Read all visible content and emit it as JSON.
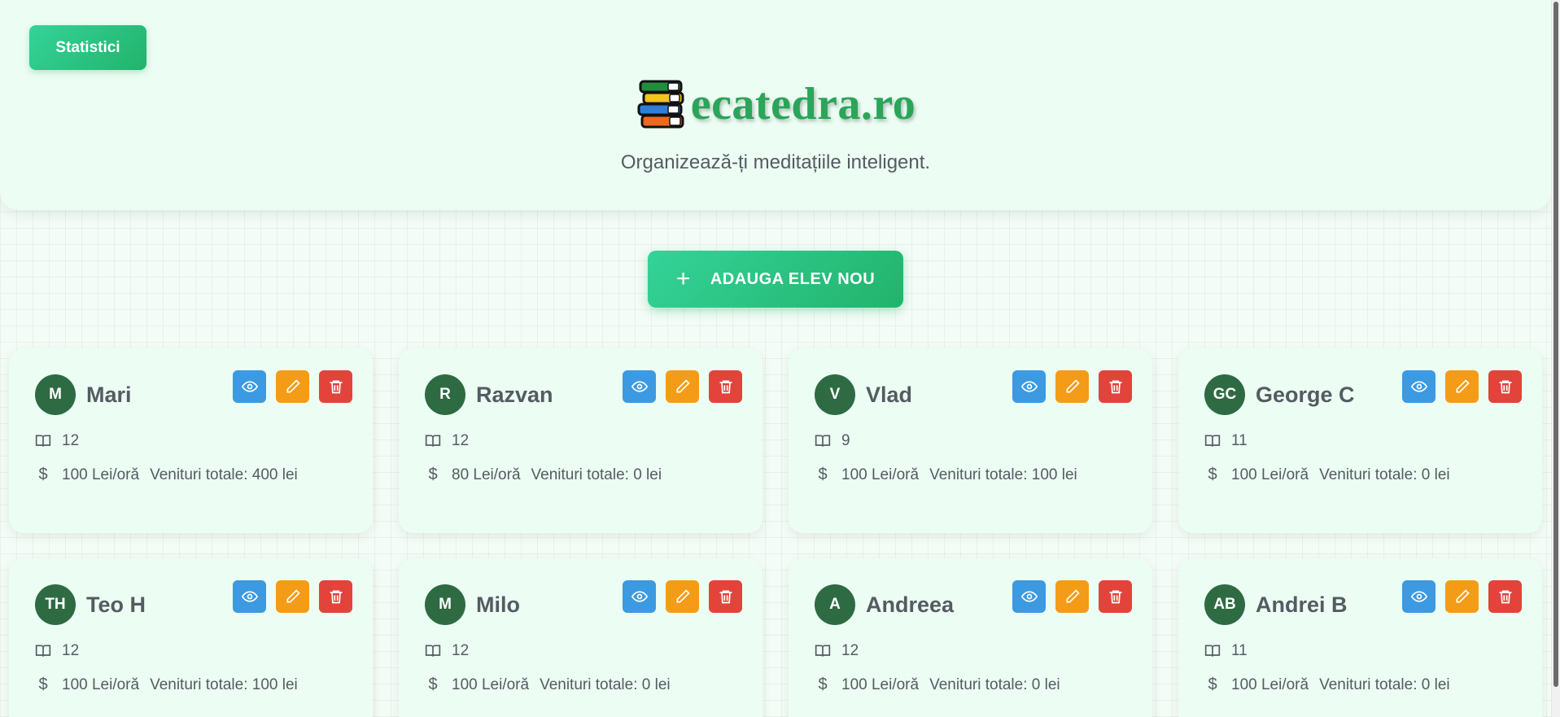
{
  "header": {
    "stats_button": "Statistici",
    "brand_name": "ecatedra.ro",
    "tagline": "Organizează-ți meditațiile inteligent."
  },
  "add_button": {
    "icon": "plus-icon",
    "label": "ADAUGA ELEV NOU"
  },
  "colors": {
    "accent": "#22b36b",
    "avatar": "#2e6b43",
    "view": "#3b9ae1",
    "edit": "#f49c17",
    "delete": "#e2433a"
  },
  "students": [
    {
      "initials": "M",
      "name": "Mari",
      "grade": "12",
      "rate": "100 Lei/oră",
      "income": "Venituri totale: 400 lei"
    },
    {
      "initials": "R",
      "name": "Razvan",
      "grade": "12",
      "rate": "80 Lei/oră",
      "income": "Venituri totale: 0 lei"
    },
    {
      "initials": "V",
      "name": "Vlad",
      "grade": "9",
      "rate": "100 Lei/oră",
      "income": "Venituri totale: 100 lei"
    },
    {
      "initials": "GC",
      "name": "George C",
      "grade": "11",
      "rate": "100 Lei/oră",
      "income": "Venituri totale: 0 lei"
    },
    {
      "initials": "TH",
      "name": "Teo H",
      "grade": "12",
      "rate": "100 Lei/oră",
      "income": "Venituri totale: 100 lei"
    },
    {
      "initials": "M",
      "name": "Milo",
      "grade": "12",
      "rate": "100 Lei/oră",
      "income": "Venituri totale: 0 lei"
    },
    {
      "initials": "A",
      "name": "Andreea",
      "grade": "12",
      "rate": "100 Lei/oră",
      "income": "Venituri totale: 0 lei"
    },
    {
      "initials": "AB",
      "name": "Andrei B",
      "grade": "11",
      "rate": "100 Lei/oră",
      "income": "Venituri totale: 0 lei"
    }
  ]
}
